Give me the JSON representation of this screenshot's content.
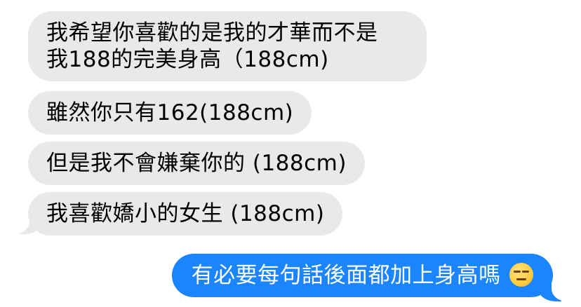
{
  "conversation": {
    "incoming_messages": [
      {
        "line1": "我希望你喜歡的是我的才華而不是",
        "line2": "我188的完美身高（188cm)"
      },
      {
        "text": "雖然你只有162(188cm)"
      },
      {
        "text": "但是我不會嫌棄你的 (188cm)"
      },
      {
        "text": "我喜歡嬌小的女生 (188cm)"
      }
    ],
    "outgoing_messages": [
      {
        "text": "有必要每句話後面都加上身高嗎",
        "emoji": "expressionless-face-icon"
      }
    ]
  },
  "colors": {
    "incoming_bubble": "#e9e9eb",
    "outgoing_bubble": "#1b84ff",
    "outgoing_text": "#ffffff",
    "incoming_text": "#000000"
  }
}
